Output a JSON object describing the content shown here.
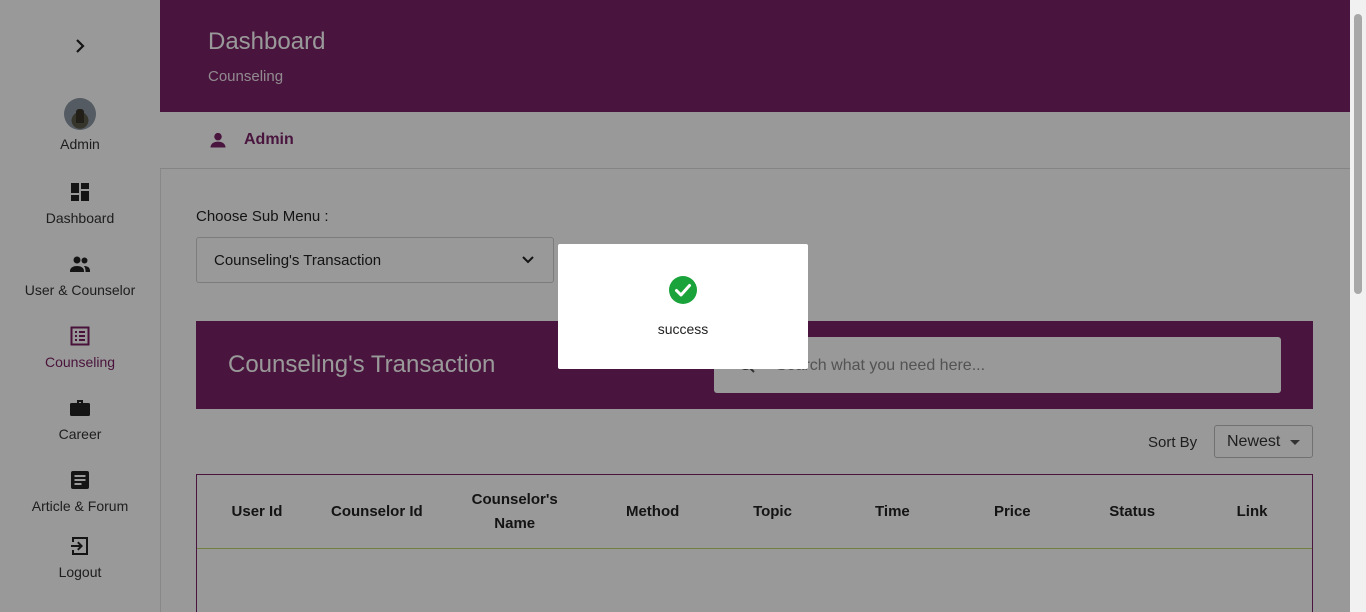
{
  "sidebar": {
    "items": [
      {
        "label": "Admin",
        "icon": "avatar"
      },
      {
        "label": "Dashboard",
        "icon": "dashboard-icon"
      },
      {
        "label": "User & Counselor",
        "icon": "people-icon"
      },
      {
        "label": "Counseling",
        "icon": "list-icon",
        "active": true
      },
      {
        "label": "Career",
        "icon": "briefcase-icon"
      },
      {
        "label": "Article & Forum",
        "icon": "article-icon"
      },
      {
        "label": "Logout",
        "icon": "logout-icon"
      }
    ]
  },
  "header": {
    "title": "Dashboard",
    "subtitle": "Counseling"
  },
  "adminbar": {
    "name": "Admin"
  },
  "submenu": {
    "label": "Choose Sub Menu :",
    "value": "Counseling's Transaction"
  },
  "panel": {
    "title": "Counseling's Transaction",
    "search_placeholder": "Search what you need here..."
  },
  "sort": {
    "label": "Sort By",
    "value": "Newest"
  },
  "table": {
    "columns": [
      "User Id",
      "Counselor Id",
      "Counselor's Name",
      "Method",
      "Topic",
      "Time",
      "Price",
      "Status",
      "Link"
    ]
  },
  "modal": {
    "message": "success"
  },
  "colors": {
    "brand": "#7b2468",
    "success": "#1aa33a"
  }
}
